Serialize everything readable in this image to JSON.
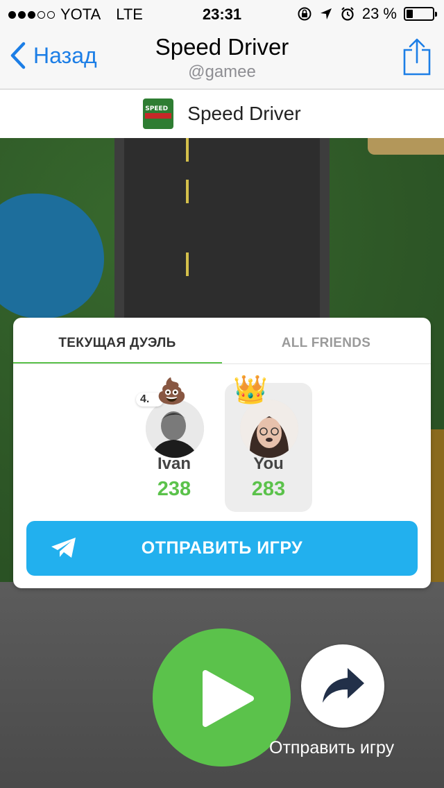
{
  "status_bar": {
    "carrier": "YOTA",
    "network": "LTE",
    "time": "23:31",
    "battery": "23 %",
    "battery_level": 0.23
  },
  "nav": {
    "back_label": "Назад",
    "title": "Speed Driver",
    "subtitle": "@gamee"
  },
  "game_header": {
    "logo_text": "SPEED",
    "name": "Speed Driver"
  },
  "card": {
    "tabs": [
      {
        "label": "ТЕКУЩАЯ ДУЭЛЬ",
        "active": true
      },
      {
        "label": "ALL FRIENDS",
        "active": false
      }
    ],
    "players": [
      {
        "rank": "4.",
        "name": "Ivan",
        "score": "238",
        "emoji": "poop"
      },
      {
        "name": "You",
        "score": "283",
        "emoji": "crown",
        "highlighted": true
      }
    ],
    "send_button": "ОТПРАВИТЬ ИГРУ"
  },
  "controls": {
    "share_caption": "Отправить игру"
  },
  "colors": {
    "accent_blue": "#1c7ee6",
    "send_blue": "#22b0ee",
    "green": "#5bc24b"
  }
}
